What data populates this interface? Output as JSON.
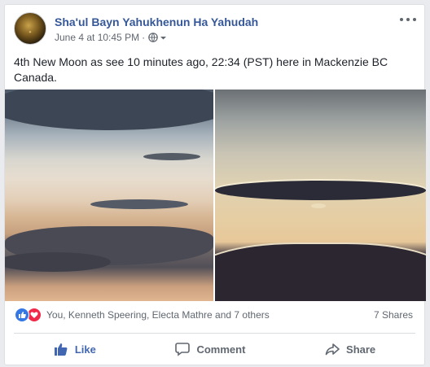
{
  "post": {
    "author": "Sha'ul Bayn Yahukhenun Ha Yahudah",
    "timestamp": "June 4 at 10:45 PM",
    "separator": "·",
    "audience_icon": "globe-icon",
    "text": "4th New Moon as see 10 minutes ago, 22:34 (PST) here in Mackenzie BC Canada."
  },
  "engagement": {
    "reactors": "You, Kenneth Speering, Electa Mathre and 7 others",
    "shares": "7 Shares",
    "reaction_icons": [
      "like-icon",
      "love-icon"
    ]
  },
  "actions": {
    "like": "Like",
    "comment": "Comment",
    "share": "Share"
  },
  "colors": {
    "link": "#365899",
    "like_active": "#4267b2",
    "secondary_text": "#606770",
    "love": "#f0284a",
    "like": "#3578e5"
  }
}
